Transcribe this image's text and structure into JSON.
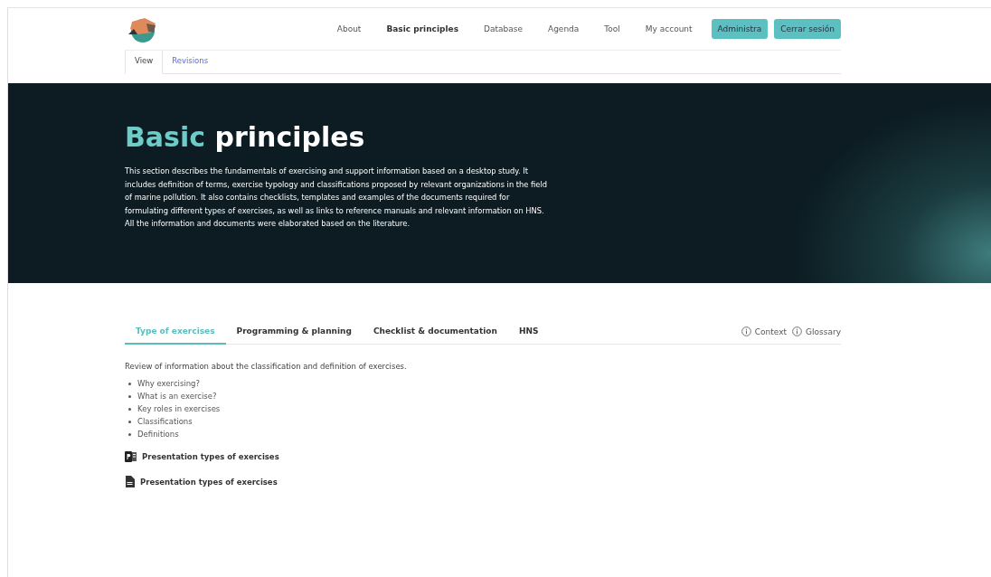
{
  "nav": {
    "items": [
      {
        "label": "About",
        "selected": false
      },
      {
        "label": "Basic principles",
        "selected": true
      },
      {
        "label": "Database",
        "selected": false
      },
      {
        "label": "Agenda",
        "selected": false
      },
      {
        "label": "Tool",
        "selected": false
      },
      {
        "label": "My account",
        "selected": false
      }
    ],
    "buttons": [
      "Administra",
      "Cerrar sesión"
    ]
  },
  "page_tabs": [
    {
      "label": "View",
      "selected": true
    },
    {
      "label": "Revisions",
      "selected": false
    }
  ],
  "hero": {
    "title_accent": "Basic",
    "title_main": "principles",
    "text": "This section describes the fundamentals of exercising and support information based on a desktop study. It includes definition of terms, exercise typology and classifications proposed by relevant organizations in the field of marine pollution. It also contains checklists, templates and examples of the documents required for formulating different types of exercises, as well as links to reference manuals and relevant information on HNS. All the information and documents were elaborated based on the literature."
  },
  "section_tabs": [
    {
      "label": "Type of exercises",
      "selected": true
    },
    {
      "label": "Programming & planning",
      "selected": false
    },
    {
      "label": "Checklist & documentation",
      "selected": false
    },
    {
      "label": "HNS",
      "selected": false
    }
  ],
  "info_links": [
    "Context",
    "Glossary"
  ],
  "intro": "Review of information about the classification and definition of exercises.",
  "topics": [
    "Why exercising?",
    "What is an exercise?",
    "Key roles in exercises",
    "Classifications",
    "Definitions"
  ],
  "documents": [
    {
      "kind": "slides",
      "label": "Presentation types of exercises"
    },
    {
      "kind": "file",
      "label": "Presentation types of exercises"
    }
  ]
}
